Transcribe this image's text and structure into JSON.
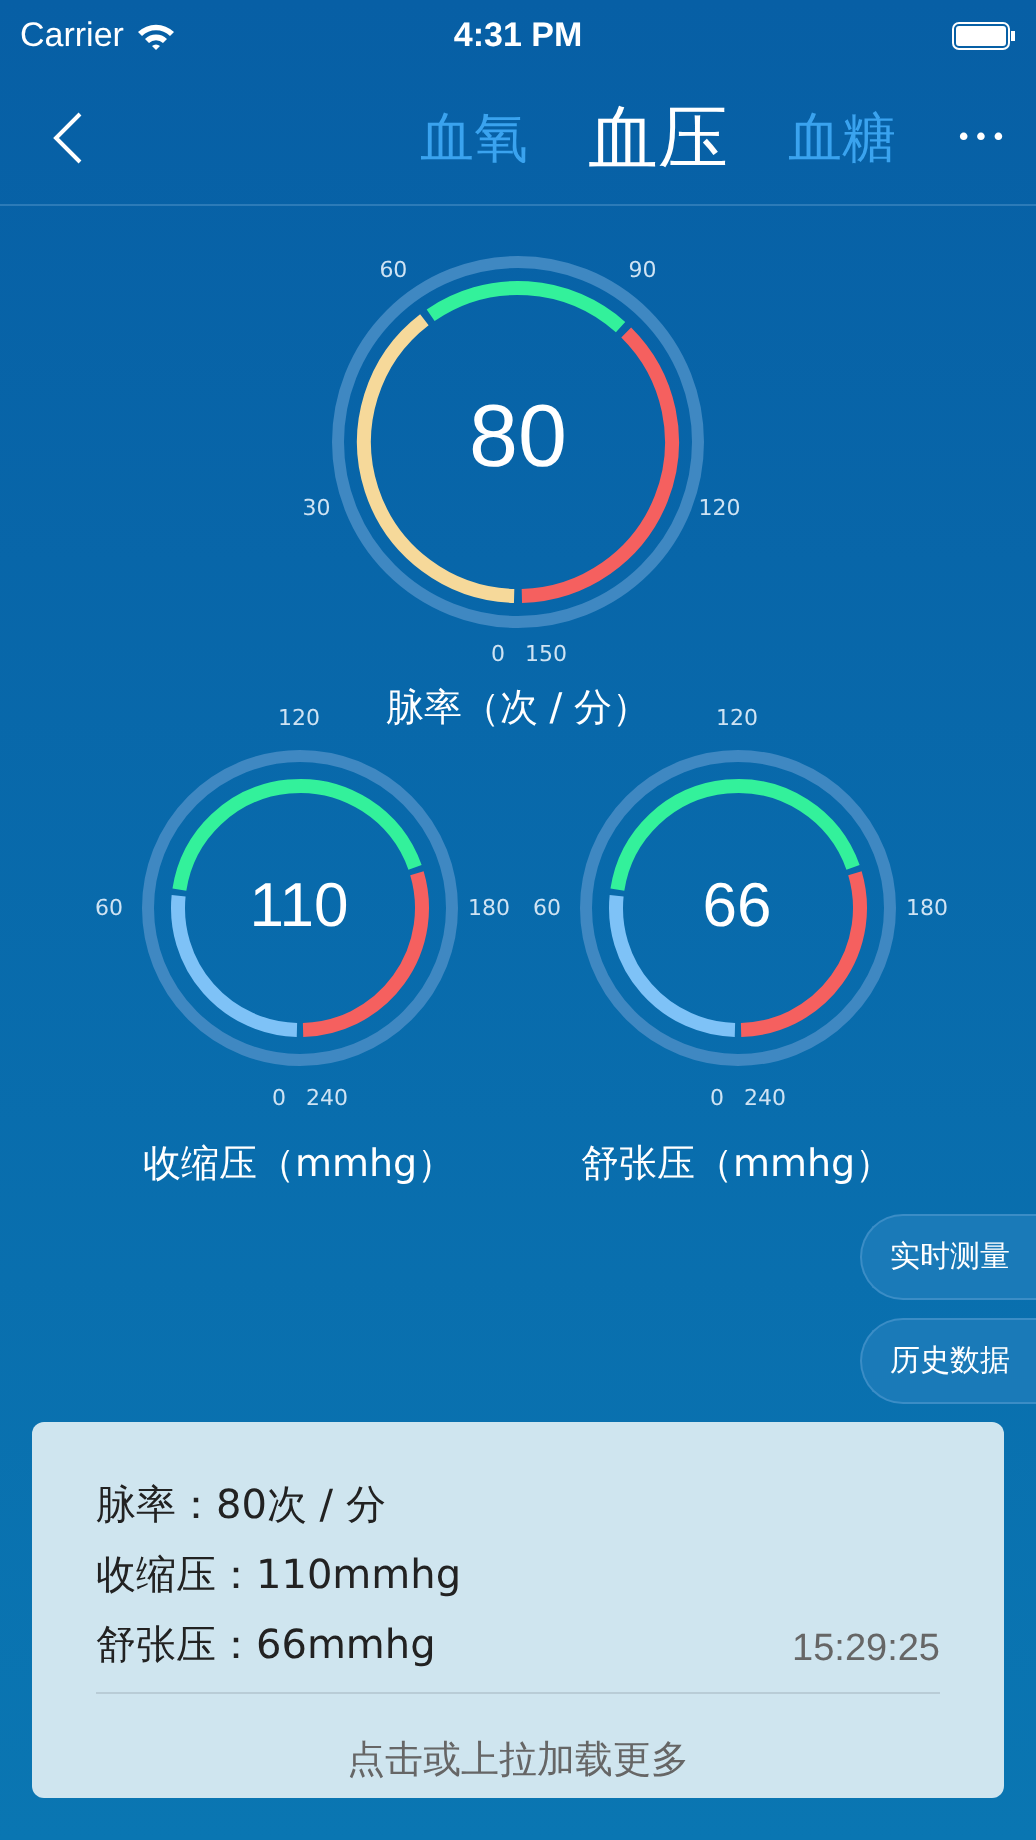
{
  "status_bar": {
    "carrier": "Carrier",
    "time": "4:31 PM"
  },
  "nav": {
    "tabs": [
      {
        "label": "血氧",
        "selected": false
      },
      {
        "label": "血压",
        "selected": true
      },
      {
        "label": "血糖",
        "selected": false
      }
    ],
    "more": "•••"
  },
  "gauges": [
    {
      "kind": "pulse",
      "value": "80",
      "ticks": [
        "0",
        "30",
        "60",
        "90",
        "120",
        "150"
      ],
      "caption": "脉率（次 / 分）"
    },
    {
      "kind": "pressure",
      "value": "110",
      "ticks": [
        "0",
        "60",
        "120",
        "180",
        "240"
      ],
      "caption": "收缩压（mmhg）"
    },
    {
      "kind": "pressure",
      "value": "66",
      "ticks": [
        "0",
        "60",
        "120",
        "180",
        "240"
      ],
      "caption": "舒张压（mmhg）"
    }
  ],
  "side_buttons": [
    "实时测量",
    "历史数据"
  ],
  "record": {
    "lines": [
      "脉率：80次 / 分",
      "收缩压：110mmhg",
      "舒张压：66mmhg"
    ],
    "time": "15:29:25",
    "load_more": "点击或上拉加载更多"
  }
}
